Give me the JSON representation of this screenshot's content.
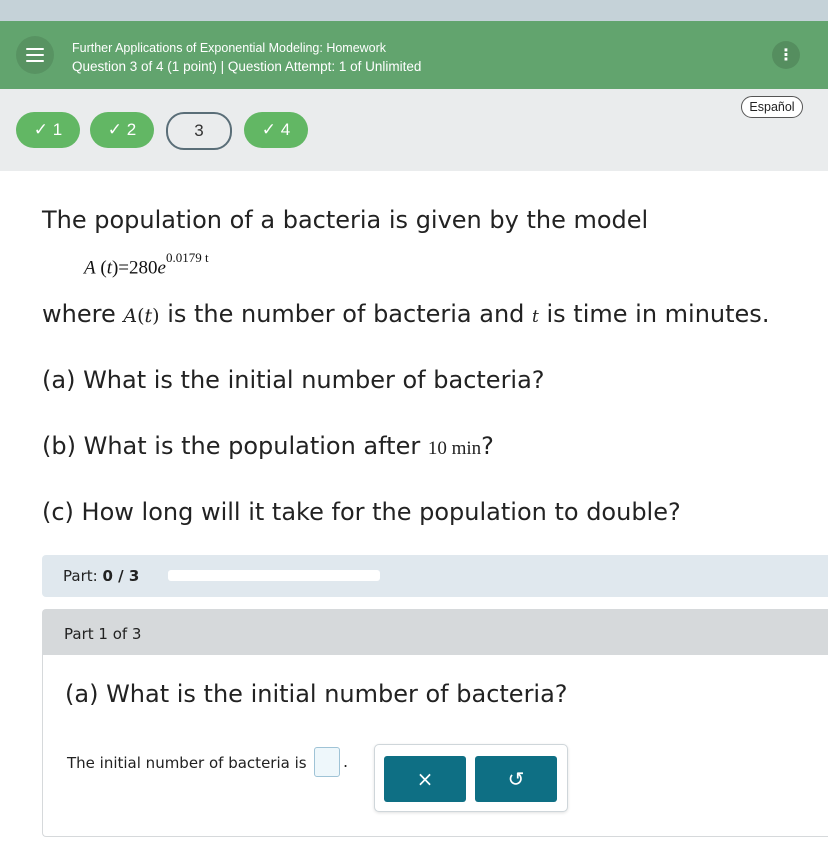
{
  "header": {
    "title": "Further Applications of Exponential Modeling: Homework",
    "subtitle": "Question 3 of 4 (1 point)  |  Question Attempt: 1 of Unlimited",
    "menu_icon": "hamburger-menu-icon",
    "more_icon": "vertical-ellipsis-icon",
    "more_glyph": "⋮",
    "color": "#62a46e"
  },
  "nav": {
    "language_button": "Español",
    "questions": [
      {
        "label": "✓ 1",
        "status": "complete"
      },
      {
        "label": "✓ 2",
        "status": "complete"
      },
      {
        "label": "3",
        "status": "current"
      },
      {
        "label": "✓ 4",
        "status": "complete"
      }
    ],
    "complete_color": "#62b764"
  },
  "question": {
    "line1": "The population of a bacteria is given by the model",
    "formula": {
      "lhs": "A",
      "arg": "t",
      "eq": "=",
      "coef": "280",
      "base": "e",
      "exponent": "0.0179 t"
    },
    "where_prefix": "where ",
    "where_A": "A",
    "where_t_arg": "t",
    "where_mid": " is the number of bacteria and ",
    "where_t": "t",
    "where_suffix": " is time in minutes.",
    "a": "(a) What is the initial number of bacteria?",
    "b_prefix": "(b) What is the population after ",
    "b_value": "10 min",
    "b_suffix": "?",
    "c": "(c) How long will it take for the population to double?"
  },
  "progress": {
    "label": "Part:",
    "value": "0 / 3",
    "fraction": 0
  },
  "part": {
    "header": "Part 1 of 3",
    "question": "(a) What is the initial number of bacteria?",
    "answer_label": "The initial number of bacteria is",
    "answer_value": "",
    "period": ".",
    "tools": [
      {
        "glyph": "×",
        "icon": "clear-x-icon"
      },
      {
        "glyph": "↺",
        "icon": "undo-icon"
      }
    ],
    "tool_color": "#0e6f84"
  }
}
